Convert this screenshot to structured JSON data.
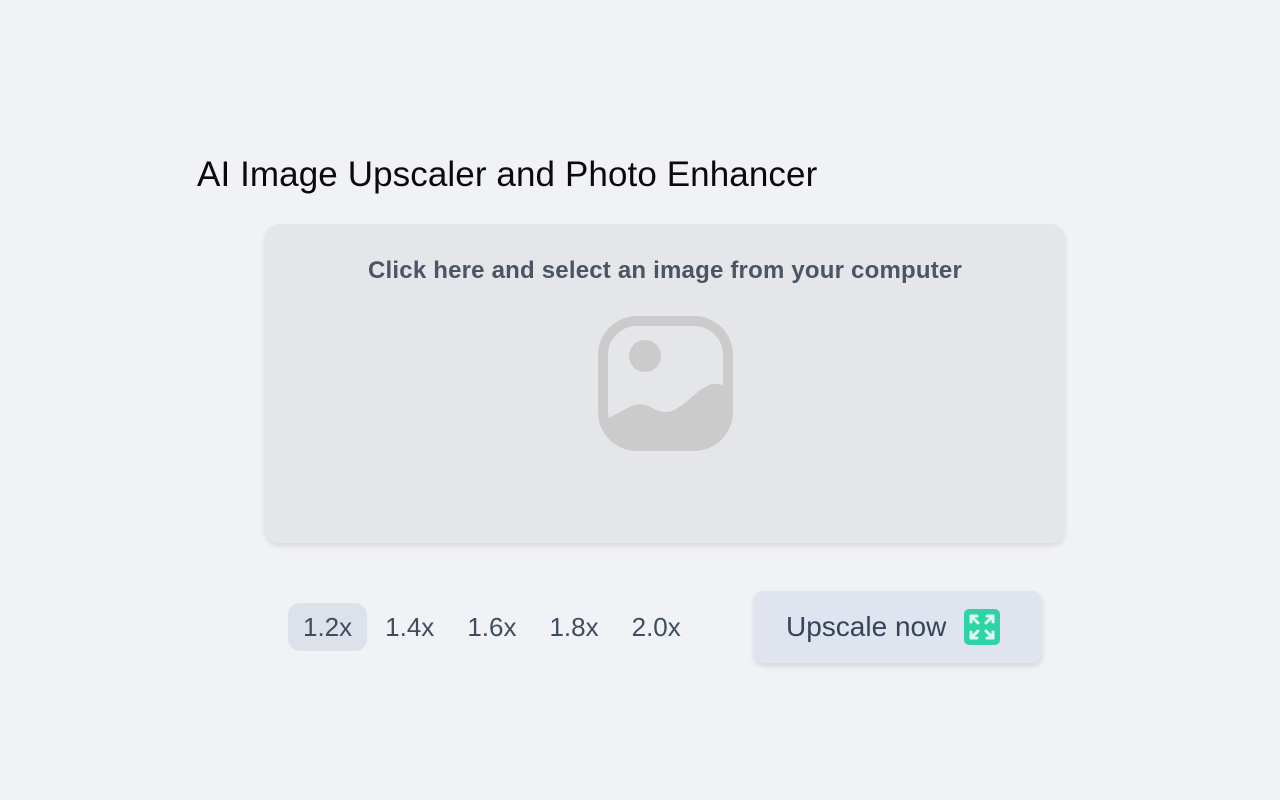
{
  "page": {
    "title": "AI Image Upscaler and Photo Enhancer"
  },
  "dropzone": {
    "instruction": "Click here and select an image from your computer",
    "icon": "image-placeholder-icon",
    "icon_color": "#cbcbcb"
  },
  "scale_options": {
    "selected": "1.2x",
    "items": [
      {
        "label": "1.2x",
        "selected": true
      },
      {
        "label": "1.4x",
        "selected": false
      },
      {
        "label": "1.6x",
        "selected": false
      },
      {
        "label": "1.8x",
        "selected": false
      },
      {
        "label": "2.0x",
        "selected": false
      }
    ]
  },
  "upscale_button": {
    "label": "Upscale now",
    "icon": "expand-icon",
    "icon_color": "#2ed3a8"
  }
}
